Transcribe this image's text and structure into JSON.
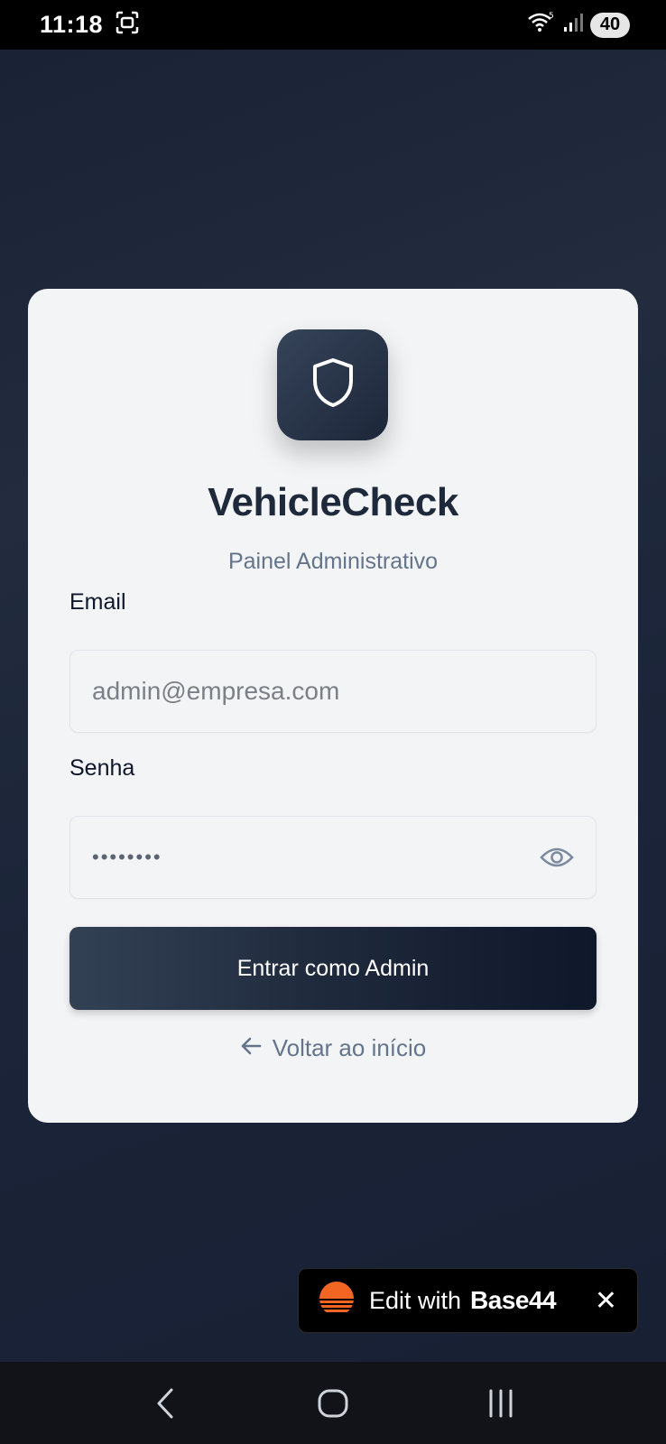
{
  "status_bar": {
    "time": "11:18",
    "battery": "40"
  },
  "login": {
    "app_name": "VehicleCheck",
    "subtitle": "Painel Administrativo",
    "email_label": "Email",
    "email_placeholder": "admin@empresa.com",
    "password_label": "Senha",
    "password_value": "••••••••",
    "submit_label": "Entrar como Admin",
    "back_label": "Voltar ao início"
  },
  "toast": {
    "text": "Edit with",
    "brand": "Base44",
    "close_symbol": "✕"
  },
  "colors": {
    "background": "#1a2234",
    "card": "#f3f4f6",
    "primary": "#1e293b",
    "muted": "#64748b",
    "brand_orange": "#f26522"
  }
}
